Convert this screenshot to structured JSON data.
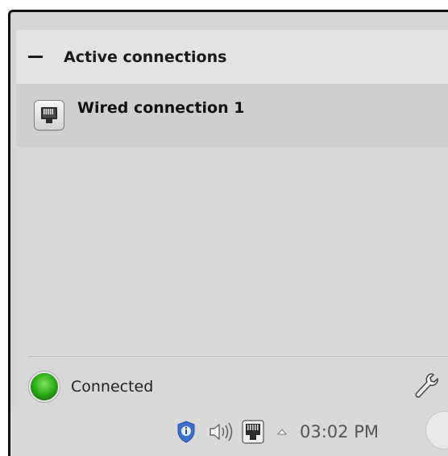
{
  "popup": {
    "section_title": "Active connections",
    "connections": [
      {
        "name": "Wired connection 1",
        "icon": "ethernet-icon"
      }
    ],
    "status": {
      "label": "Connected",
      "indicator_color": "#33b21c"
    },
    "settings_icon": "wrench-icon"
  },
  "taskbar": {
    "tray_icons": [
      "security-shield-icon",
      "volume-icon",
      "network-ethernet-icon",
      "show-hidden-icons-arrow"
    ],
    "clock": "03:02 PM"
  }
}
